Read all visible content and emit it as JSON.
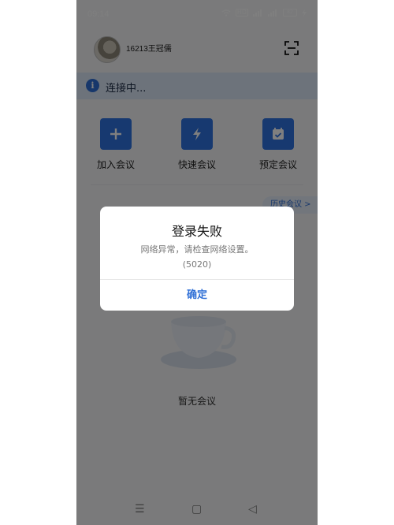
{
  "status_bar": {
    "time": "09:14",
    "network_label": "HD",
    "battery_level": "82"
  },
  "header": {
    "username": "16213王冠儒"
  },
  "connection": {
    "status_text": "连接中..."
  },
  "actions": [
    {
      "label": "加入会议",
      "icon": "plus-icon"
    },
    {
      "label": "快速会议",
      "icon": "lightning-icon"
    },
    {
      "label": "预定会议",
      "icon": "calendar-icon"
    }
  ],
  "history_button": {
    "label": "历史会议 >"
  },
  "empty_state": {
    "text": "暂无会议"
  },
  "nav_bar": {
    "menu_glyph": "☰",
    "home_glyph": "▢",
    "back_glyph": "◁"
  },
  "dialog": {
    "title": "登录失败",
    "message_line1": "网络异常，请检查网络设置。",
    "message_line2": "(5020)",
    "ok_label": "确定"
  },
  "colors": {
    "accent": "#2f73e0",
    "overlay": "rgba(0,0,0,0.50)",
    "background": "#f4f5f7"
  }
}
